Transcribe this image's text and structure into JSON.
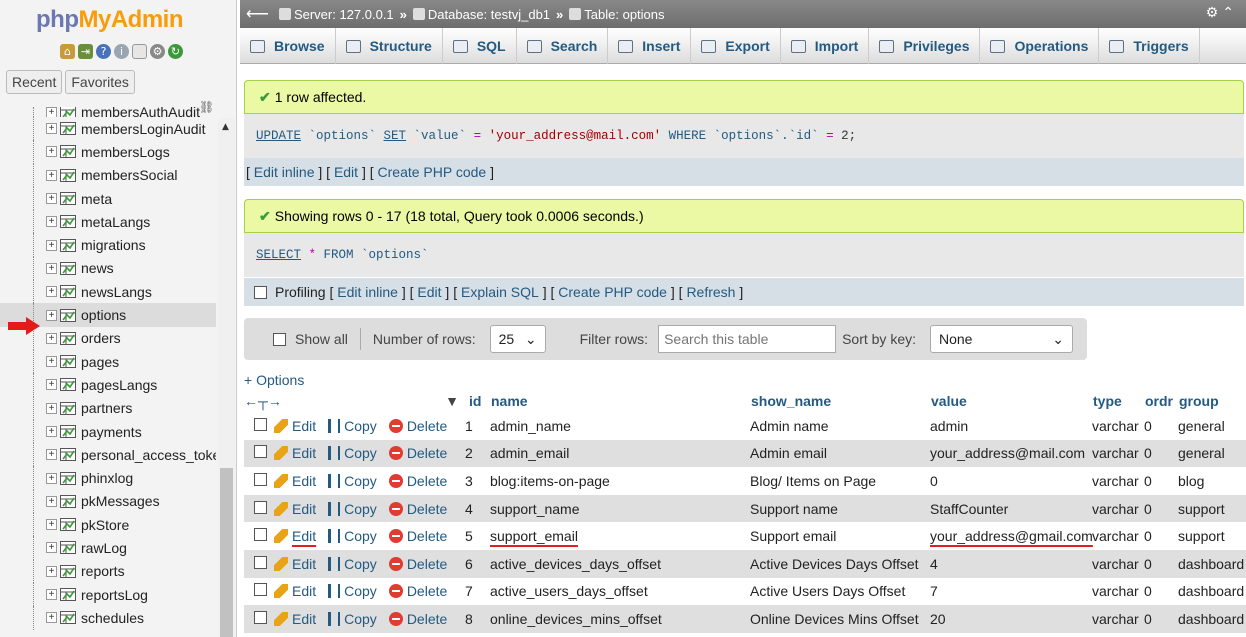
{
  "nav": {
    "logo_php": "php",
    "logo_myadmin": "MyAdmin",
    "recent_label": "Recent",
    "favorites_label": "Favorites",
    "tables": [
      "membersAuthAudit",
      "membersLoginAudit",
      "membersLogs",
      "membersSocial",
      "meta",
      "metaLangs",
      "migrations",
      "news",
      "newsLangs",
      "options",
      "orders",
      "pages",
      "pagesLangs",
      "partners",
      "payments",
      "personal_access_toke",
      "phinxlog",
      "pkMessages",
      "pkStore",
      "rawLog",
      "reports",
      "reportsLog",
      "schedules"
    ],
    "selected": "options"
  },
  "breadcrumb": {
    "server": "Server: 127.0.0.1",
    "database": "Database: testvj_db1",
    "table": "Table: options"
  },
  "tabs": [
    "Browse",
    "Structure",
    "SQL",
    "Search",
    "Insert",
    "Export",
    "Import",
    "Privileges",
    "Operations",
    "Triggers"
  ],
  "update_msg": {
    "text": "1 row affected.",
    "sql_update": "UPDATE",
    "sql_table": " `options` ",
    "sql_set": "SET",
    "sql_col": " `value` ",
    "sql_eq": "=",
    "sql_val": " 'your_address@mail.com' ",
    "sql_where": "WHERE",
    "sql_cond": " `options`.`id` ",
    "sql_eq2": "=",
    "sql_num": " 2;",
    "links": [
      "Edit inline",
      "Edit",
      "Create PHP code"
    ]
  },
  "select_msg": {
    "text": "Showing rows 0 - 17 (18 total, Query took 0.0006 seconds.)",
    "sql_select": "SELECT",
    "sql_star": " * ",
    "sql_from": "FROM",
    "sql_table": " `options`",
    "profiling": "Profiling",
    "links": [
      "Edit inline",
      "Edit",
      "Explain SQL",
      "Create PHP code",
      "Refresh"
    ]
  },
  "filter": {
    "show_all": "Show all",
    "num_rows_label": "Number of rows:",
    "num_rows_value": "25",
    "filter_label": "Filter rows:",
    "filter_placeholder": "Search this table",
    "sort_label": "Sort by key:",
    "sort_value": "None"
  },
  "options_link": "+ Options",
  "table": {
    "headers": {
      "id": "id",
      "name": "name",
      "show_name": "show_name",
      "value": "value",
      "type": "type",
      "ordr": "ordr",
      "group": "group"
    },
    "actions": {
      "edit": "Edit",
      "copy": "Copy",
      "delete": "Delete"
    },
    "rows": [
      {
        "id": "1",
        "name": "admin_name",
        "show_name": "Admin name",
        "value": "admin",
        "type": "varchar",
        "ordr": "0",
        "group": "general"
      },
      {
        "id": "2",
        "name": "admin_email",
        "show_name": "Admin email",
        "value": "your_address@mail.com",
        "type": "varchar",
        "ordr": "0",
        "group": "general"
      },
      {
        "id": "3",
        "name": "blog:items-on-page",
        "show_name": "Blog/ Items on Page",
        "value": "0",
        "type": "varchar",
        "ordr": "0",
        "group": "blog"
      },
      {
        "id": "4",
        "name": "support_name",
        "show_name": "Support name",
        "value": "StaffCounter",
        "type": "varchar",
        "ordr": "0",
        "group": "support"
      },
      {
        "id": "5",
        "name": "support_email",
        "show_name": "Support email",
        "value": "your_address@gmail.com",
        "type": "varchar",
        "ordr": "0",
        "group": "support"
      },
      {
        "id": "6",
        "name": "active_devices_days_offset",
        "show_name": "Active Devices Days Offset",
        "value": "4",
        "type": "varchar",
        "ordr": "0",
        "group": "dashboard"
      },
      {
        "id": "7",
        "name": "active_users_days_offset",
        "show_name": "Active Users Days Offset",
        "value": "7",
        "type": "varchar",
        "ordr": "0",
        "group": "dashboard"
      },
      {
        "id": "8",
        "name": "online_devices_mins_offset",
        "show_name": "Online Devices Mins Offset",
        "value": "20",
        "type": "varchar",
        "ordr": "0",
        "group": "dashboard"
      }
    ]
  }
}
